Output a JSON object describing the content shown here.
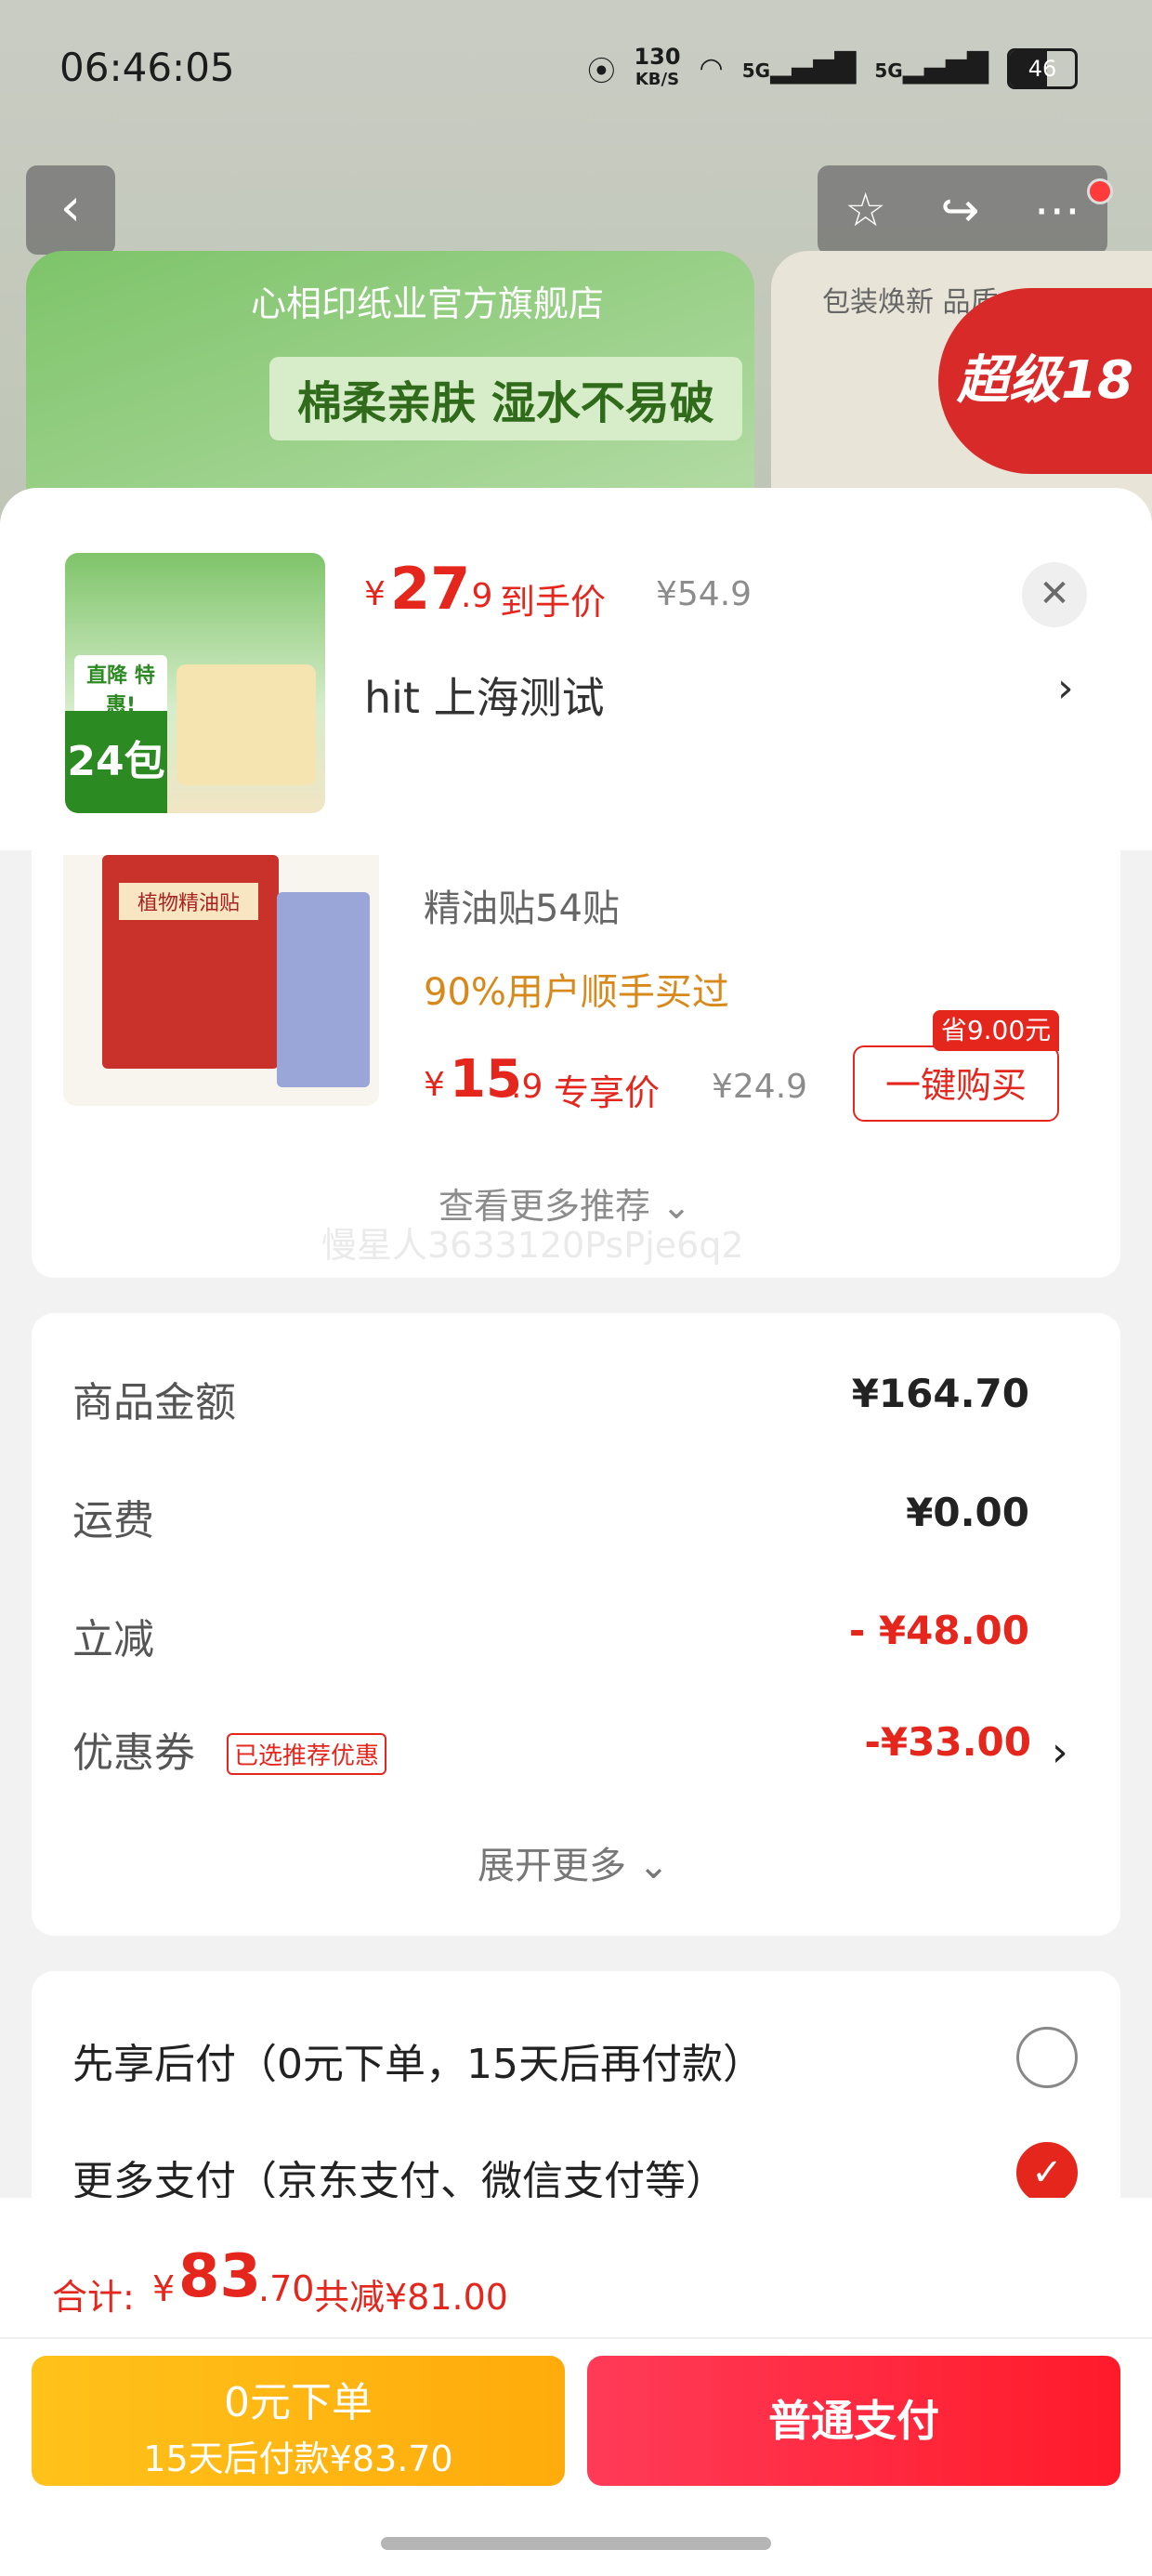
{
  "status_bar": {
    "time": "06:46:05",
    "net_speed": "130",
    "net_unit": "KB/S",
    "signal1": "5G",
    "signal2": "5G",
    "battery": "46"
  },
  "background": {
    "shop_name": "心相印纸业官方旗舰店",
    "slogan": "棉柔亲肤 湿水不易破",
    "side_text": "包装焕新 品质",
    "side_badge": "超级18"
  },
  "product": {
    "price_currency": "¥",
    "price_integer": "27",
    "price_decimal": ".9",
    "price_label": "到手价",
    "original_price": "¥54.9",
    "address": "hit  上海测试",
    "thumb_count": "24包",
    "thumb_tag": "直降 特惠!"
  },
  "recommendation": {
    "name": "精油贴54贴",
    "bought_text": "90%用户顺手买过",
    "price_currency": "¥",
    "price_integer": "15",
    "price_decimal": ".9",
    "price_label": "专享价",
    "original_price": "¥24.9",
    "save_badge": "省9.00元",
    "buy_button": "一键购买",
    "img_label": "植物精油贴",
    "more_label": "查看更多推荐 ⌄",
    "watermark": "慢星人3633120PsPje6q2"
  },
  "price_detail": {
    "rows": [
      {
        "label": "商品金额",
        "value": "¥164.70"
      },
      {
        "label": "运费",
        "value": "¥0.00"
      },
      {
        "label": "立减",
        "value": "- ¥48.00"
      },
      {
        "label": "优惠券",
        "value": "-¥33.00"
      }
    ],
    "coupon_tag": "已选推荐优惠",
    "expand_label": "展开更多 ⌄"
  },
  "payment": {
    "options": [
      {
        "label": "先享后付（0元下单，15天后再付款）",
        "selected": false
      },
      {
        "label": "更多支付（京东支付、微信支付等）",
        "selected": true
      }
    ]
  },
  "footer": {
    "total_label": "合计:",
    "total_currency": "¥",
    "total_integer": "83",
    "total_decimal": ".70",
    "total_saved": "共减¥81.00",
    "btn_zero_line1": "0元下单",
    "btn_zero_line2": "15天后付款¥83.70",
    "btn_pay": "普通支付"
  },
  "colors": {
    "accent": "#e4261d",
    "orange": "#ffb515",
    "bought": "#d8891c"
  }
}
